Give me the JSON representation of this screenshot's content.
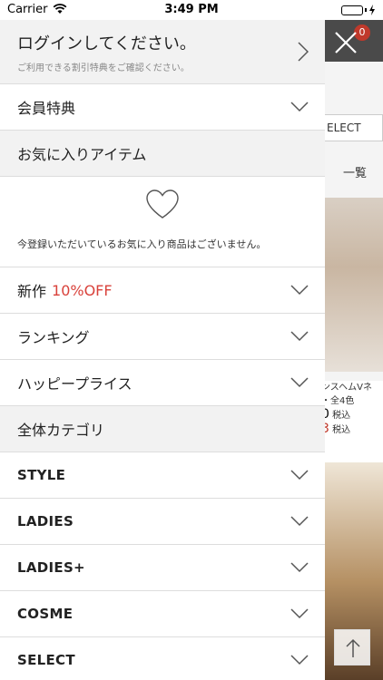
{
  "status_bar": {
    "carrier": "Carrier",
    "time": "3:49 PM"
  },
  "drawer": {
    "login": {
      "title": "ログインしてください。",
      "subtitle": "ご利用できる割引特典をご確認ください。"
    },
    "member_benefits": "会員特典",
    "favorites": {
      "title": "お気に入りアイテム",
      "empty_text": "今登録いただいているお気に入り商品はございません。"
    },
    "new_arrivals": {
      "label": "新作",
      "discount": "10%OFF"
    },
    "ranking": "ランキング",
    "happy_price": "ハッピープライス",
    "all_categories": "全体カテゴリ",
    "categories": [
      "STYLE",
      "LADIES",
      "LADIES+",
      "COSME",
      "SELECT"
    ]
  },
  "background_page": {
    "cart_count": "0",
    "select_tab": "ELECT",
    "list_link": "一覧",
    "product_desc_1": "ンスヘムVネ",
    "product_desc_2": "・全4色",
    "price_1": "0",
    "price_1_tax": "税込",
    "price_2": "3",
    "price_2_tax": "税込"
  },
  "colors": {
    "accent_red": "#d9423b",
    "header_dark": "#4a4a4a",
    "drawer_grey": "#f2f2f2",
    "battery_green": "#4cd964"
  }
}
